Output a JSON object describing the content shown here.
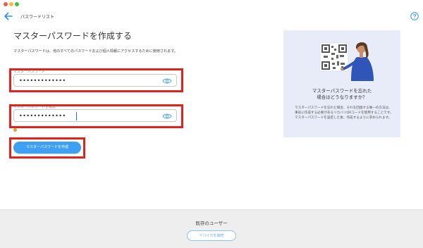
{
  "window": {
    "controls": [
      "close",
      "minimize",
      "zoom"
    ]
  },
  "header": {
    "back_icon": "arrow-left-icon",
    "breadcrumb": "パスワードリスト",
    "help_icon": "question-circle-icon"
  },
  "main": {
    "title": "マスターパスワードを作成する",
    "description": "マスターパスワードは、他のすべてのパスワードおよび個人情報にアクセスするために使用されます。",
    "password_field": {
      "label": "マスターパスワード",
      "value": "•••••••••••••",
      "eye_icon": "eye-icon"
    },
    "confirm_field": {
      "label": "マスターパスワードを確認",
      "value": "•••••••••••••",
      "eye_icon": "eye-icon"
    },
    "strength_hint": "",
    "create_button": "マスターパスワードを作成"
  },
  "side_panel": {
    "illustration": "person-with-qr-code-illustration",
    "title_line1": "マスターパスワードを忘れた",
    "title_line2": "場合はどうなりますか？",
    "text": "マスターパスワードを忘れた場合、それを回復する唯一の方法は、事前に作成する必要があるリカバリQRコードを使用することです。マスターパスワードを設定した後、作成するように求められます。"
  },
  "footer": {
    "title": "既存のユーザー",
    "connect_button": "デバイスを接続"
  },
  "colors": {
    "accent": "#3ea0f3",
    "highlight_box": "#e3231b",
    "panel_bg": "#e8ecf8"
  }
}
